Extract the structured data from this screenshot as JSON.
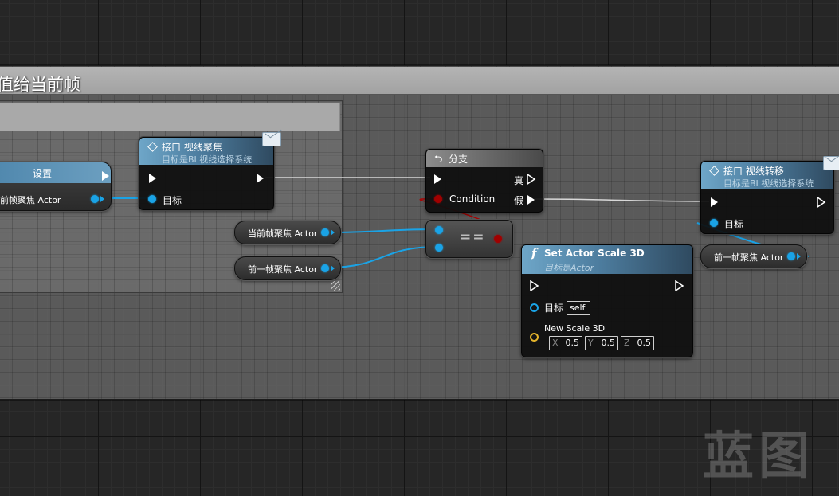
{
  "comment": {
    "title": "值给当前帧"
  },
  "nodes": {
    "set_node": {
      "title": "设置",
      "var_label": "当前帧聚焦 Actor"
    },
    "interface_focus": {
      "title": "接口 视线聚焦",
      "subtitle": "目标是BI 视线选择系统",
      "target_label": "目标"
    },
    "branch": {
      "title": "分支",
      "true_label": "真",
      "false_label": "假",
      "condition_label": "Condition"
    },
    "equal": {
      "symbol": "=="
    },
    "var_current": {
      "label": "当前帧聚焦 Actor"
    },
    "var_previous": {
      "label": "前一帧聚焦 Actor"
    },
    "set_scale": {
      "title": "Set Actor Scale 3D",
      "subtitle": "目标是Actor",
      "target_label": "目标",
      "target_value": "self",
      "scale_label": "New Scale 3D",
      "x_axis": "X",
      "x_value": "0.5",
      "y_axis": "Y",
      "y_value": "0.5",
      "z_axis": "Z",
      "z_value": "0.5"
    },
    "interface_shift": {
      "title": "接口 视线转移",
      "subtitle": "目标是BI 视线选择系统",
      "target_label": "目标"
    },
    "var_previous_right": {
      "label": "前一帧聚焦 Actor"
    }
  },
  "watermark": "蓝图",
  "colors": {
    "object_pin": "#1aa3e6",
    "bool_pin": "#a00000",
    "vector_pin": "#e3b32b",
    "exec_wire": "#d8d8d8",
    "function_header": "#4d7d9f"
  }
}
